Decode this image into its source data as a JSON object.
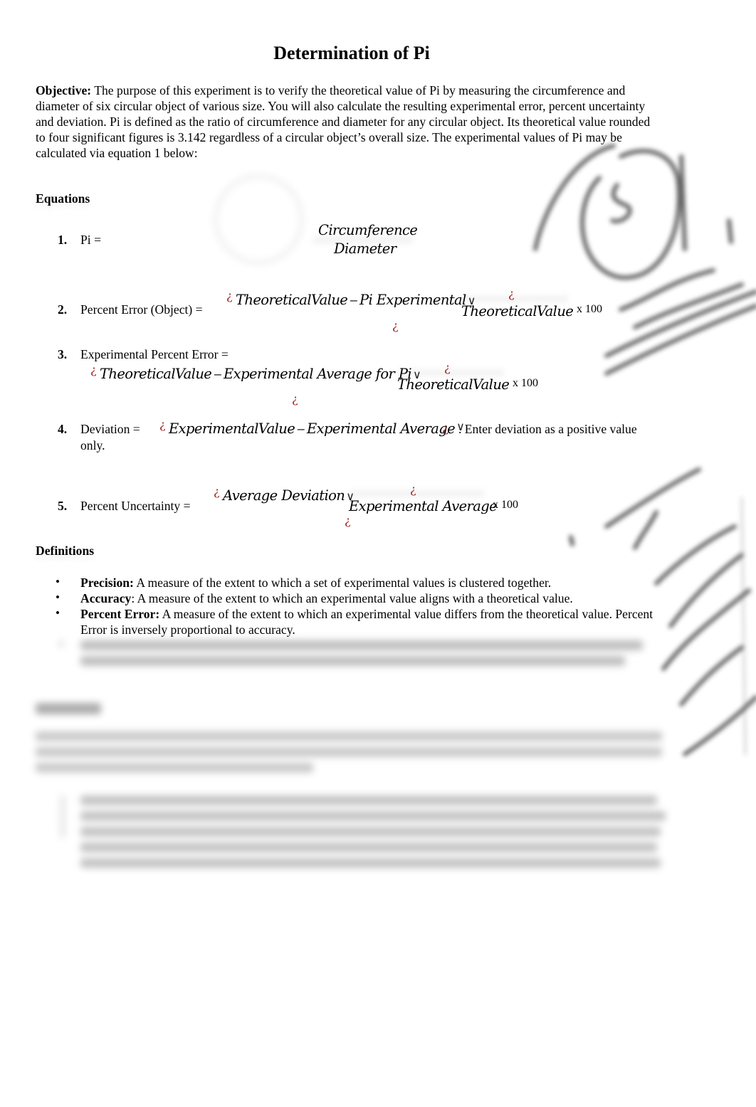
{
  "document": {
    "title": "Determination of Pi",
    "objective": {
      "label": "Objective:",
      "text": " The purpose of this experiment is to verify the theoretical value of Pi by measuring the circumference and diameter of six circular object of various size. You will also calculate the resulting experimental error, percent uncertainty and deviation. Pi is defined as the ratio of circumference and diameter for any circular object. Its theoretical value rounded to four significant figures is 3.142 regardless of a circular object’s overall size. The experimental values of Pi may be calculated via equation 1 below:"
    },
    "equations": {
      "heading": "Equations",
      "items": [
        {
          "number": "1.",
          "label": "Pi =",
          "numerator": "Circumference",
          "denominator": "Diameter"
        },
        {
          "number": "2.",
          "label": "Percent Error (Object) =",
          "term_a": "TheoreticalValue",
          "minus": "−",
          "term_b": "Pi Experimental",
          "bar": "∨",
          "denominator": "TheoreticalValue",
          "multiplier": "x 100",
          "glyph": "¿"
        },
        {
          "number": "3.",
          "label": "Experimental Percent Error  =",
          "term_a": "TheoreticalValue",
          "minus": "−",
          "term_b": "Experimental Average for Pi",
          "bar": "∨",
          "denominator": "TheoreticalValue",
          "multiplier": "x 100",
          "glyph": "¿"
        },
        {
          "number": "4.",
          "label": "Deviation =",
          "term_a": "ExperimentalValue",
          "minus": "−",
          "term_b": "Experimental Average",
          "bar": "∨",
          "suffix": ". Enter deviation as a positive value",
          "suffix_cont": "only.",
          "glyph": "¿"
        },
        {
          "number": "5.",
          "label": "Percent Uncertainty =",
          "term_a": "Average Deviation",
          "bar": "∨",
          "denominator": "Experimental Average",
          "multiplier": "x 100",
          "glyph": "¿"
        }
      ]
    },
    "definitions": {
      "heading": "Definitions",
      "bullet": "•",
      "items": [
        {
          "term": "Precision:",
          "text": " A measure of the extent to which a set of experimental values is clustered together."
        },
        {
          "term": "Accuracy",
          "text": ": A measure of the extent to which an experimental value aligns with a theoretical value."
        },
        {
          "term": "Percent Error:",
          "text": " A measure of the extent to which an experimental value differs from the theoretical value. Percent Error is inversely proportional to accuracy."
        }
      ]
    }
  }
}
